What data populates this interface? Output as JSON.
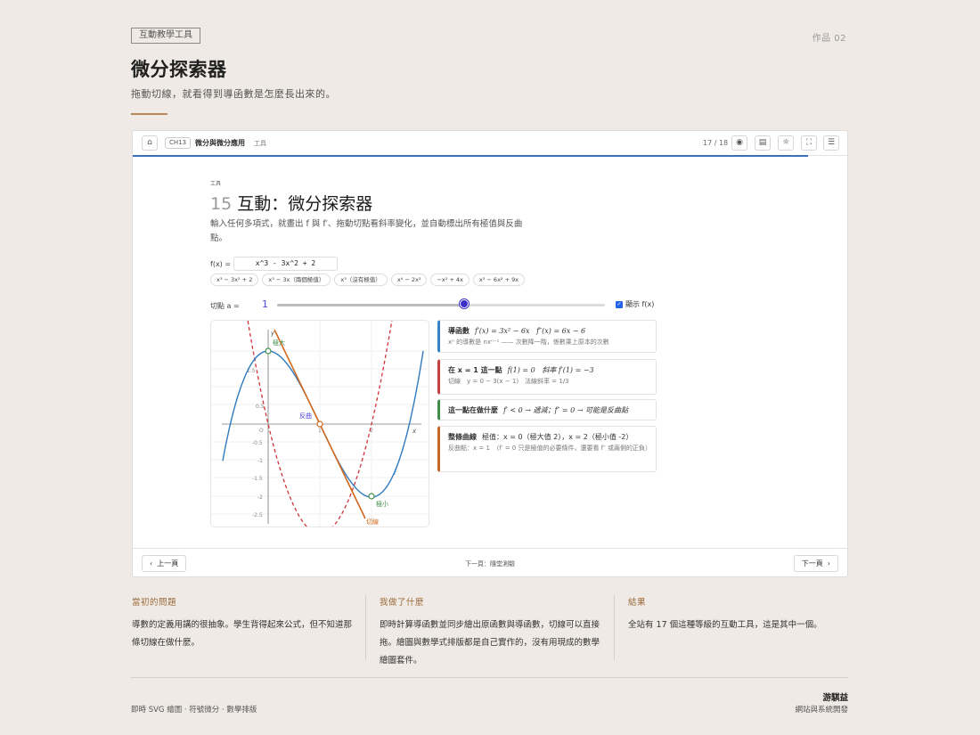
{
  "header": {
    "tag": "互動教學工具",
    "work_no": "作品 02",
    "title": "微分探索器",
    "subtitle": "拖動切線，就看得到導函數是怎麼長出來的。"
  },
  "slide": {
    "chapter_badge": "CH13",
    "chapter_title": "微分與微分應用",
    "chapter_type": "工具",
    "page_count": "17 / 18",
    "icons": [
      "home-icon",
      "eye-icon",
      "note-icon",
      "sun-icon",
      "fullscreen-icon",
      "menu-icon"
    ],
    "small_label": "工具",
    "section_num": "15",
    "section_title": "互動：微分探索器",
    "description": "輸入任何多項式，就畫出 f 與 f′、拖動切點看斜率變化，並自動標出所有極值與反曲點。",
    "fx_label": "f(x) =",
    "fx_value": "x^3 - 3x^2 + 2",
    "presets": [
      "x³ − 3x² + 2",
      "x³ − 3x（兩個極值）",
      "x³（沒有極值）",
      "x⁴ − 2x²",
      "−x² + 4x",
      "x³ − 6x² + 9x"
    ],
    "tangent_label": "切點 a =",
    "tangent_value": "1",
    "tangent_fraction": 0.57,
    "show_fx_label": "顯示 f(x)",
    "show_fx_checked": true,
    "plot": {
      "y_ticks": [
        "1.5",
        "0.5",
        "-0.5",
        "-1",
        "-1.5",
        "-2",
        "-2.5"
      ],
      "origin": "O",
      "x_tick_1": "1",
      "x_tick_2": "2",
      "x_axis": "x",
      "y_axis": "y",
      "label_max": "極大",
      "label_min": "極小",
      "label_inflect": "反曲",
      "label_tangent": "切線",
      "label_f": "f"
    },
    "card1": {
      "title": "導函數",
      "formula1": "f′(x) = 3x² − 6x",
      "formula2": "f″(x) = 6x − 6",
      "sub": "xⁿ 的導數是 nxⁿ⁻¹ —— 次數降一階，係數乘上原本的次數"
    },
    "card2": {
      "title": "在 x = 1 這一點",
      "formula1": "f(1) = 0",
      "slope": "斜率 f′(1) = −3",
      "sub": "切線　y = 0 − 3(x − 1)　法線斜率 = 1/3"
    },
    "card3": {
      "title": "這一點在做什麼",
      "text": "f′ < 0 → 遞減；f″ = 0 → 可能是反曲點"
    },
    "card4": {
      "title": "整條曲線",
      "text": "極值：x = 0（極大值 2），x = 2（極小值 -2）",
      "sub": "反曲點：x = 1　（f′ = 0 只是極值的必要條件，還要看 f″ 或兩側的正負）"
    },
    "prev_label": "上一頁",
    "next_hint": "下一頁：隨堂測驗",
    "next_label": "下一頁"
  },
  "columns": [
    {
      "heading": "當初的問題",
      "text": "導數的定義用講的很抽象。學生背得起來公式，但不知道那條切線在做什麼。"
    },
    {
      "heading": "我做了什麼",
      "text": "即時計算導函數並同步繪出原函數與導函數，切線可以直接拖。繪圖與數學式排版都是自己實作的，沒有用現成的數學繪圖套件。"
    },
    {
      "heading": "結果",
      "text": "全站有 17 個這種等級的互動工具，這是其中一個。"
    }
  ],
  "footer": {
    "tech": "即時 SVG 繪圖 · 符號微分 · 數學排版",
    "name": "游騏益",
    "role": "網站與系統開發"
  },
  "colors": {
    "background": "#efeae5",
    "accent": "#b48a5c",
    "f_curve": "#2f7ac0",
    "derivative_curve": "#d0343b",
    "tangent_line": "#d2691e",
    "slider_knob": "#3b2fc9"
  }
}
